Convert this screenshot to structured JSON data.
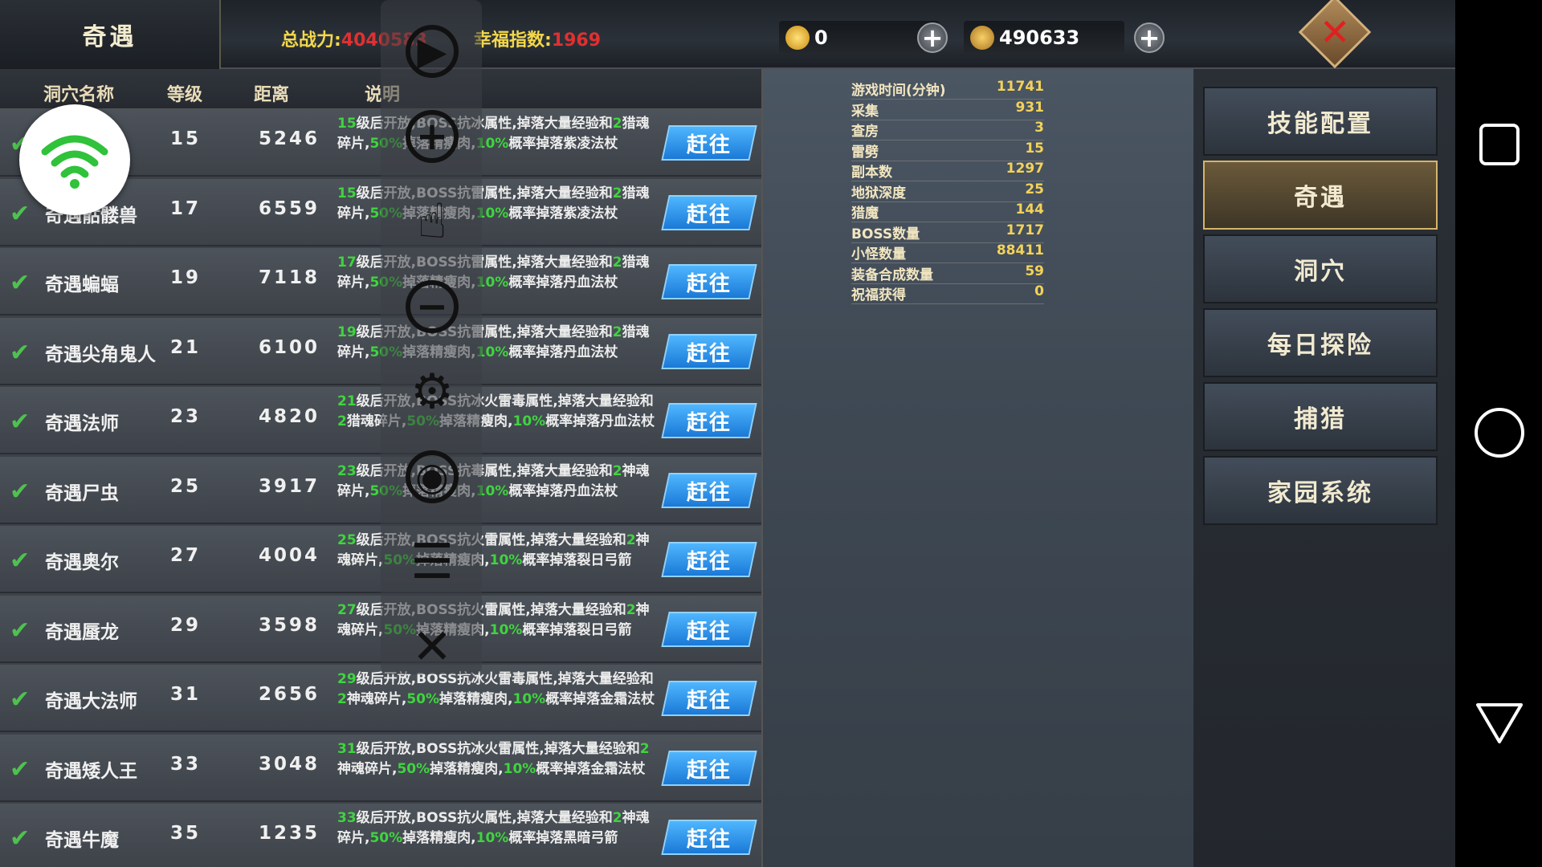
{
  "topbar": {
    "title": "奇遇",
    "power_label": "总战力:",
    "power_value": "4040583",
    "happy_label": "幸福指数:",
    "happy_value": "1969",
    "gold": "0",
    "coins": "490633",
    "close_icon": "close-icon"
  },
  "table": {
    "headers": [
      "洞穴名称",
      "等级",
      "距离",
      "说明"
    ],
    "go_label": "赶往",
    "rows": [
      {
        "name": "",
        "level": "15",
        "dist": "5246",
        "d1": "15",
        "t1": "级后开放,BOSS抗冰属性,掉落大量经验和",
        "d2": "2",
        "t2": "猎魂碎片,",
        "d3": "50%",
        "t3": "掉落精瘦肉,",
        "d4": "10%",
        "t4": "概率掉落紫凌法杖"
      },
      {
        "name": "奇遇骷髅兽",
        "level": "17",
        "dist": "6559",
        "d1": "15",
        "t1": "级后开放,BOSS抗雷属性,掉落大量经验和",
        "d2": "2",
        "t2": "猎魂碎片,",
        "d3": "50%",
        "t3": "掉落精瘦肉,",
        "d4": "10%",
        "t4": "概率掉落紫凌法杖"
      },
      {
        "name": "奇遇蝙蝠",
        "level": "19",
        "dist": "7118",
        "d1": "17",
        "t1": "级后开放,BOSS抗雷属性,掉落大量经验和",
        "d2": "2",
        "t2": "猎魂碎片,",
        "d3": "50%",
        "t3": "掉落精瘦肉,",
        "d4": "10%",
        "t4": "概率掉落丹血法杖"
      },
      {
        "name": "奇遇尖角鬼人",
        "level": "21",
        "dist": "6100",
        "d1": "19",
        "t1": "级后开放,BOSS抗雷属性,掉落大量经验和",
        "d2": "2",
        "t2": "猎魂碎片,",
        "d3": "50%",
        "t3": "掉落精瘦肉,",
        "d4": "10%",
        "t4": "概率掉落丹血法杖"
      },
      {
        "name": "奇遇法师",
        "level": "23",
        "dist": "4820",
        "d1": "21",
        "t1": "级后开放,BOSS抗冰火雷毒属性,掉落大量经验和",
        "d2": "2",
        "t2": "猎魂碎片,",
        "d3": "50%",
        "t3": "掉落精瘦肉,",
        "d4": "10%",
        "t4": "概率掉落丹血法杖"
      },
      {
        "name": "奇遇尸虫",
        "level": "25",
        "dist": "3917",
        "d1": "23",
        "t1": "级后开放,BOSS抗毒属性,掉落大量经验和",
        "d2": "2",
        "t2": "神魂碎片,",
        "d3": "50%",
        "t3": "掉落精瘦肉,",
        "d4": "10%",
        "t4": "概率掉落丹血法杖"
      },
      {
        "name": "奇遇奥尔",
        "level": "27",
        "dist": "4004",
        "d1": "25",
        "t1": "级后开放,BOSS抗火雷属性,掉落大量经验和",
        "d2": "2",
        "t2": "神魂碎片,",
        "d3": "50%",
        "t3": "掉落精瘦肉,",
        "d4": "10%",
        "t4": "概率掉落裂日弓箭"
      },
      {
        "name": "奇遇蜃龙",
        "level": "29",
        "dist": "3598",
        "d1": "27",
        "t1": "级后开放,BOSS抗火雷属性,掉落大量经验和",
        "d2": "2",
        "t2": "神魂碎片,",
        "d3": "50%",
        "t3": "掉落精瘦肉,",
        "d4": "10%",
        "t4": "概率掉落裂日弓箭"
      },
      {
        "name": "奇遇大法师",
        "level": "31",
        "dist": "2656",
        "d1": "29",
        "t1": "级后开放,BOSS抗冰火雷毒属性,掉落大量经验和",
        "d2": "2",
        "t2": "神魂碎片,",
        "d3": "50%",
        "t3": "掉落精瘦肉,",
        "d4": "10%",
        "t4": "概率掉落金霜法杖"
      },
      {
        "name": "奇遇矮人王",
        "level": "33",
        "dist": "3048",
        "d1": "31",
        "t1": "级后开放,BOSS抗冰火雷属性,掉落大量经验和",
        "d2": "2",
        "t2": "神魂碎片,",
        "d3": "50%",
        "t3": "掉落精瘦肉,",
        "d4": "10%",
        "t4": "概率掉落金霜法杖"
      },
      {
        "name": "奇遇牛魔",
        "level": "35",
        "dist": "1235",
        "d1": "33",
        "t1": "级后开放,BOSS抗火属性,掉落大量经验和",
        "d2": "2",
        "t2": "神魂碎片,",
        "d3": "50%",
        "t3": "掉落精瘦肉,",
        "d4": "10%",
        "t4": "概率掉落黑暗弓箭"
      }
    ]
  },
  "stats": [
    {
      "k": "游戏时间(分钟)",
      "v": "11741"
    },
    {
      "k": "采集",
      "v": "931"
    },
    {
      "k": "查房",
      "v": "3"
    },
    {
      "k": "雷劈",
      "v": "15"
    },
    {
      "k": "副本数",
      "v": "1297"
    },
    {
      "k": "地狱深度",
      "v": "25"
    },
    {
      "k": "猎魔",
      "v": "144"
    },
    {
      "k": "BOSS数量",
      "v": "1717"
    },
    {
      "k": "小怪数量",
      "v": "88411"
    },
    {
      "k": "装备合成数量",
      "v": "59"
    },
    {
      "k": "祝福获得",
      "v": "0"
    }
  ],
  "menu": [
    "技能配置",
    "奇遇",
    "洞穴",
    "每日探险",
    "捕猎",
    "家园系统"
  ],
  "active_menu": 1,
  "overlay": {
    "icons": [
      "play-icon",
      "zoom-in-icon",
      "hand-pointer-icon",
      "zoom-out-icon",
      "gear-icon",
      "eye-icon",
      "menu-icon",
      "close-icon"
    ]
  },
  "colors": {
    "accent_green": "#3fd43f",
    "accent_red": "#e03030",
    "button_blue": "#1a79d6",
    "gold": "#f3d25a"
  }
}
